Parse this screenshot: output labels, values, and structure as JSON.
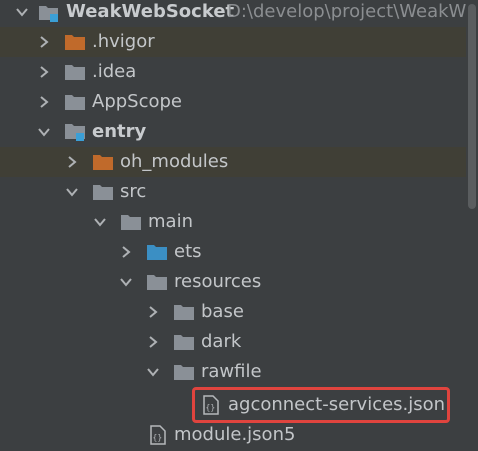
{
  "project_root": {
    "name": "WeakWebSocket",
    "path": "D:\\develop\\project\\WeakWeb"
  },
  "items": [
    {
      "label": ".hvigor",
      "icon": "folder-excluded-icon",
      "expanded": false
    },
    {
      "label": ".idea",
      "icon": "folder-icon",
      "expanded": false
    },
    {
      "label": "AppScope",
      "icon": "folder-icon",
      "expanded": false
    },
    {
      "label": "entry",
      "icon": "module-folder-icon",
      "expanded": true
    },
    {
      "label": "oh_modules",
      "icon": "folder-excluded-icon",
      "expanded": false
    },
    {
      "label": "src",
      "icon": "folder-icon",
      "expanded": true
    },
    {
      "label": "main",
      "icon": "folder-icon",
      "expanded": true
    },
    {
      "label": "ets",
      "icon": "source-folder-icon",
      "expanded": false
    },
    {
      "label": "resources",
      "icon": "folder-icon",
      "expanded": true
    },
    {
      "label": "base",
      "icon": "folder-icon",
      "expanded": false
    },
    {
      "label": "dark",
      "icon": "folder-icon",
      "expanded": false
    },
    {
      "label": "rawfile",
      "icon": "folder-icon",
      "expanded": true
    },
    {
      "label": "agconnect-services.json",
      "icon": "json-file-icon",
      "highlighted": true
    },
    {
      "label": "module.json5",
      "icon": "json-file-icon"
    }
  ],
  "colors": {
    "background": "#3c3f41",
    "excluded_row": "#403f36",
    "folder": "#8a9097",
    "excluded_folder": "#c06a2b",
    "source_folder": "#3b8fc4",
    "module_marker": "#3b9fd6",
    "highlight_border": "#e0443e"
  }
}
